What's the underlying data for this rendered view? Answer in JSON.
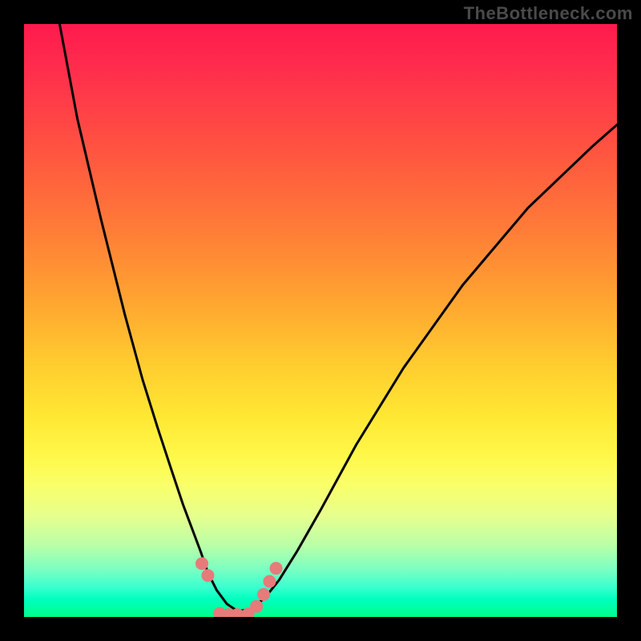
{
  "watermark": "TheBottleneck.com",
  "chart_data": {
    "type": "line",
    "title": "",
    "xlabel": "",
    "ylabel": "",
    "xlim": [
      0,
      1
    ],
    "ylim": [
      0,
      1
    ],
    "series": [
      {
        "name": "bottleneck-curve-black",
        "color": "#000000",
        "stroke_width": 3,
        "x": [
          0.06,
          0.09,
          0.13,
          0.17,
          0.2,
          0.225,
          0.248,
          0.268,
          0.283,
          0.298,
          0.31,
          0.325,
          0.342,
          0.36,
          0.382,
          0.406,
          0.43,
          0.46,
          0.5,
          0.56,
          0.64,
          0.74,
          0.85,
          0.96,
          1.0
        ],
        "values": [
          1.0,
          0.84,
          0.67,
          0.51,
          0.4,
          0.32,
          0.25,
          0.19,
          0.15,
          0.11,
          0.075,
          0.045,
          0.022,
          0.01,
          0.013,
          0.032,
          0.062,
          0.11,
          0.18,
          0.29,
          0.42,
          0.56,
          0.69,
          0.795,
          0.83
        ]
      },
      {
        "name": "bottom-dots-pink",
        "color": "#e77a7a",
        "marker_radius": 8,
        "x": [
          0.3,
          0.31,
          0.33,
          0.345,
          0.36,
          0.378,
          0.392,
          0.404,
          0.414,
          0.425
        ],
        "values": [
          0.09,
          0.07,
          0.006,
          0.004,
          0.004,
          0.005,
          0.018,
          0.038,
          0.06,
          0.082
        ]
      }
    ]
  }
}
